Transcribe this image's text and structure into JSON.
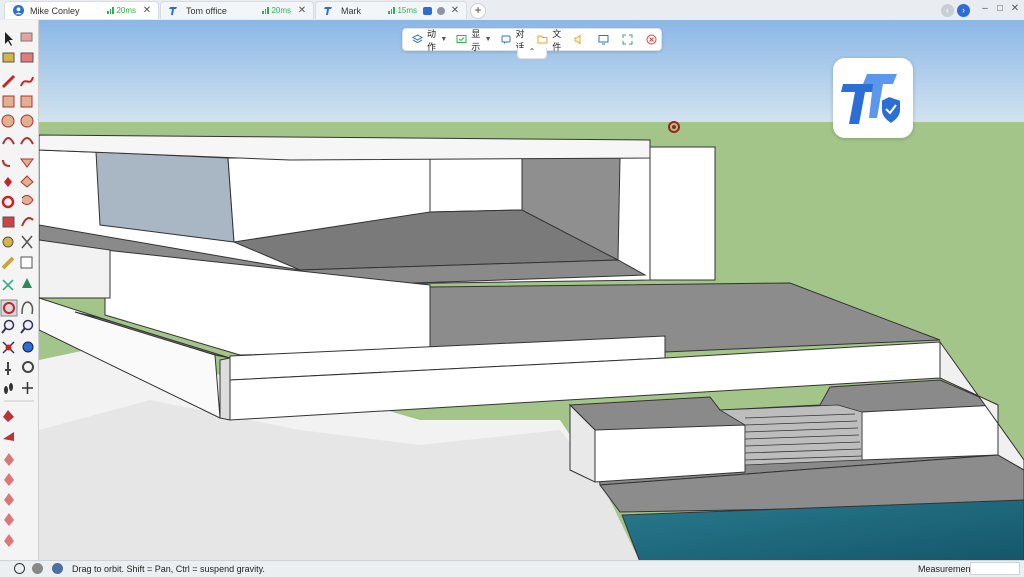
{
  "tabs": [
    {
      "label": "Mike Conley",
      "ping": "20ms"
    },
    {
      "label": "Tom office",
      "ping": "20ms"
    },
    {
      "label": "Mark",
      "ping": "15ms"
    }
  ],
  "tab_close": "✕",
  "new_tab": "+",
  "window_controls": {
    "minimize": "–",
    "maximize": "□",
    "close": "✕"
  },
  "remote_toolbar": {
    "actions": "动作",
    "display": "显示",
    "chat": "对话",
    "files": "文件",
    "collapse": "⌃"
  },
  "status": {
    "hint": "Drag to orbit.  Shift = Pan, Ctrl = suspend gravity.",
    "measurements_label": "Measurements",
    "measurements_value": ""
  },
  "colors": {
    "sky_top": "#8ab7e6",
    "ground": "#a4c58a",
    "accent_blue": "#2b6fd6",
    "ping_green": "#2bb24c",
    "pool": "#1e6f82"
  },
  "icons": [
    "user-avatar-icon",
    "teamviewer-icon",
    "signal-icon",
    "chat-icon",
    "layers-icon",
    "display-icon",
    "file-icon",
    "speaker-icon",
    "monitor-icon",
    "fullscreen-icon",
    "close-circle-icon",
    "select-arrow-icon",
    "eraser-icon",
    "pencil-icon",
    "orbit-icon",
    "zoom-icon",
    "footprint-icon",
    "info-icon",
    "user-icon",
    "help-icon"
  ]
}
